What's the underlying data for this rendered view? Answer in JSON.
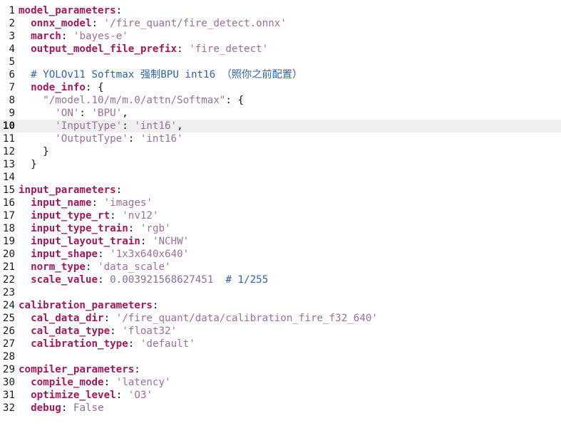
{
  "editor": {
    "current_line": 10,
    "lines": [
      {
        "n": "1",
        "tokens": [
          {
            "t": "key",
            "v": "model_parameters"
          },
          {
            "t": "punc",
            "v": ":"
          }
        ]
      },
      {
        "n": "2",
        "tokens": [
          {
            "t": "ws",
            "v": "  "
          },
          {
            "t": "key",
            "v": "onnx_model"
          },
          {
            "t": "punc",
            "v": ": "
          },
          {
            "t": "str",
            "v": "'/fire_quant/fire_detect.onnx'"
          }
        ]
      },
      {
        "n": "3",
        "tokens": [
          {
            "t": "ws",
            "v": "  "
          },
          {
            "t": "key",
            "v": "march"
          },
          {
            "t": "punc",
            "v": ": "
          },
          {
            "t": "str",
            "v": "'bayes-e'"
          }
        ]
      },
      {
        "n": "4",
        "tokens": [
          {
            "t": "ws",
            "v": "  "
          },
          {
            "t": "key",
            "v": "output_model_file_prefix"
          },
          {
            "t": "punc",
            "v": ": "
          },
          {
            "t": "str",
            "v": "'fire_detect'"
          }
        ]
      },
      {
        "n": "5",
        "tokens": []
      },
      {
        "n": "6",
        "tokens": [
          {
            "t": "ws",
            "v": "  "
          },
          {
            "t": "comment",
            "v": "# YOLOv11 Softmax "
          },
          {
            "t": "comment-cjk",
            "v": "强制"
          },
          {
            "t": "comment",
            "v": "BPU int16 "
          },
          {
            "t": "comment-cjk",
            "v": "（照你之前配置）"
          }
        ]
      },
      {
        "n": "7",
        "tokens": [
          {
            "t": "ws",
            "v": "  "
          },
          {
            "t": "key",
            "v": "node_info"
          },
          {
            "t": "punc",
            "v": ": {"
          }
        ]
      },
      {
        "n": "8",
        "tokens": [
          {
            "t": "ws",
            "v": "    "
          },
          {
            "t": "str",
            "v": "\"/model.10/m/m.0/attn/Softmax\""
          },
          {
            "t": "punc",
            "v": ": {"
          }
        ]
      },
      {
        "n": "9",
        "tokens": [
          {
            "t": "ws",
            "v": "      "
          },
          {
            "t": "str",
            "v": "'ON'"
          },
          {
            "t": "punc",
            "v": ": "
          },
          {
            "t": "str",
            "v": "'BPU'"
          },
          {
            "t": "punc",
            "v": ","
          }
        ]
      },
      {
        "n": "10",
        "tokens": [
          {
            "t": "ws",
            "v": "      "
          },
          {
            "t": "str",
            "v": "'InputType'"
          },
          {
            "t": "punc",
            "v": ": "
          },
          {
            "t": "str",
            "v": "'int16'"
          },
          {
            "t": "punc",
            "v": ","
          }
        ]
      },
      {
        "n": "11",
        "tokens": [
          {
            "t": "ws",
            "v": "      "
          },
          {
            "t": "str",
            "v": "'OutputType'"
          },
          {
            "t": "punc",
            "v": ": "
          },
          {
            "t": "str",
            "v": "'int16'"
          }
        ]
      },
      {
        "n": "12",
        "tokens": [
          {
            "t": "ws",
            "v": "    "
          },
          {
            "t": "punc",
            "v": "}"
          }
        ]
      },
      {
        "n": "13",
        "tokens": [
          {
            "t": "ws",
            "v": "  "
          },
          {
            "t": "punc",
            "v": "}"
          }
        ]
      },
      {
        "n": "14",
        "tokens": []
      },
      {
        "n": "15",
        "tokens": [
          {
            "t": "key",
            "v": "input_parameters"
          },
          {
            "t": "punc",
            "v": ":"
          }
        ]
      },
      {
        "n": "16",
        "tokens": [
          {
            "t": "ws",
            "v": "  "
          },
          {
            "t": "key",
            "v": "input_name"
          },
          {
            "t": "punc",
            "v": ": "
          },
          {
            "t": "str",
            "v": "'images'"
          }
        ]
      },
      {
        "n": "17",
        "tokens": [
          {
            "t": "ws",
            "v": "  "
          },
          {
            "t": "key",
            "v": "input_type_rt"
          },
          {
            "t": "punc",
            "v": ": "
          },
          {
            "t": "str",
            "v": "'nv12'"
          }
        ]
      },
      {
        "n": "18",
        "tokens": [
          {
            "t": "ws",
            "v": "  "
          },
          {
            "t": "key",
            "v": "input_type_train"
          },
          {
            "t": "punc",
            "v": ": "
          },
          {
            "t": "str",
            "v": "'rgb'"
          }
        ]
      },
      {
        "n": "19",
        "tokens": [
          {
            "t": "ws",
            "v": "  "
          },
          {
            "t": "key",
            "v": "input_layout_train"
          },
          {
            "t": "punc",
            "v": ": "
          },
          {
            "t": "str",
            "v": "'NCHW'"
          }
        ]
      },
      {
        "n": "20",
        "tokens": [
          {
            "t": "ws",
            "v": "  "
          },
          {
            "t": "key",
            "v": "input_shape"
          },
          {
            "t": "punc",
            "v": ": "
          },
          {
            "t": "str",
            "v": "'1x3x640x640'"
          }
        ]
      },
      {
        "n": "21",
        "tokens": [
          {
            "t": "ws",
            "v": "  "
          },
          {
            "t": "key",
            "v": "norm_type"
          },
          {
            "t": "punc",
            "v": ": "
          },
          {
            "t": "str",
            "v": "'data_scale'"
          }
        ]
      },
      {
        "n": "22",
        "tokens": [
          {
            "t": "ws",
            "v": "  "
          },
          {
            "t": "key",
            "v": "scale_value"
          },
          {
            "t": "punc",
            "v": ": "
          },
          {
            "t": "num",
            "v": "0.003921568627451"
          },
          {
            "t": "ws",
            "v": "  "
          },
          {
            "t": "comment",
            "v": "# 1/255"
          }
        ]
      },
      {
        "n": "23",
        "tokens": []
      },
      {
        "n": "24",
        "tokens": [
          {
            "t": "key",
            "v": "calibration_parameters"
          },
          {
            "t": "punc",
            "v": ":"
          }
        ]
      },
      {
        "n": "25",
        "tokens": [
          {
            "t": "ws",
            "v": "  "
          },
          {
            "t": "key",
            "v": "cal_data_dir"
          },
          {
            "t": "punc",
            "v": ": "
          },
          {
            "t": "str",
            "v": "'/fire_quant/data/calibration_fire_f32_640'"
          }
        ]
      },
      {
        "n": "26",
        "tokens": [
          {
            "t": "ws",
            "v": "  "
          },
          {
            "t": "key",
            "v": "cal_data_type"
          },
          {
            "t": "punc",
            "v": ": "
          },
          {
            "t": "str",
            "v": "'float32'"
          }
        ]
      },
      {
        "n": "27",
        "tokens": [
          {
            "t": "ws",
            "v": "  "
          },
          {
            "t": "key",
            "v": "calibration_type"
          },
          {
            "t": "punc",
            "v": ": "
          },
          {
            "t": "str",
            "v": "'default'"
          }
        ]
      },
      {
        "n": "28",
        "tokens": []
      },
      {
        "n": "29",
        "tokens": [
          {
            "t": "key",
            "v": "compiler_parameters"
          },
          {
            "t": "punc",
            "v": ":"
          }
        ]
      },
      {
        "n": "30",
        "tokens": [
          {
            "t": "ws",
            "v": "  "
          },
          {
            "t": "key",
            "v": "compile_mode"
          },
          {
            "t": "punc",
            "v": ": "
          },
          {
            "t": "str",
            "v": "'latency'"
          }
        ]
      },
      {
        "n": "31",
        "tokens": [
          {
            "t": "ws",
            "v": "  "
          },
          {
            "t": "key",
            "v": "optimize_level"
          },
          {
            "t": "punc",
            "v": ": "
          },
          {
            "t": "str",
            "v": "'O3'"
          }
        ]
      },
      {
        "n": "32",
        "tokens": [
          {
            "t": "ws",
            "v": "  "
          },
          {
            "t": "key",
            "v": "debug"
          },
          {
            "t": "punc",
            "v": ": "
          },
          {
            "t": "kw",
            "v": "False"
          }
        ]
      }
    ]
  },
  "colors": {
    "key": "#a2185a",
    "string": "#9b6e9b",
    "comment": "#2f63a6",
    "current_line_bg": "#efefef"
  }
}
